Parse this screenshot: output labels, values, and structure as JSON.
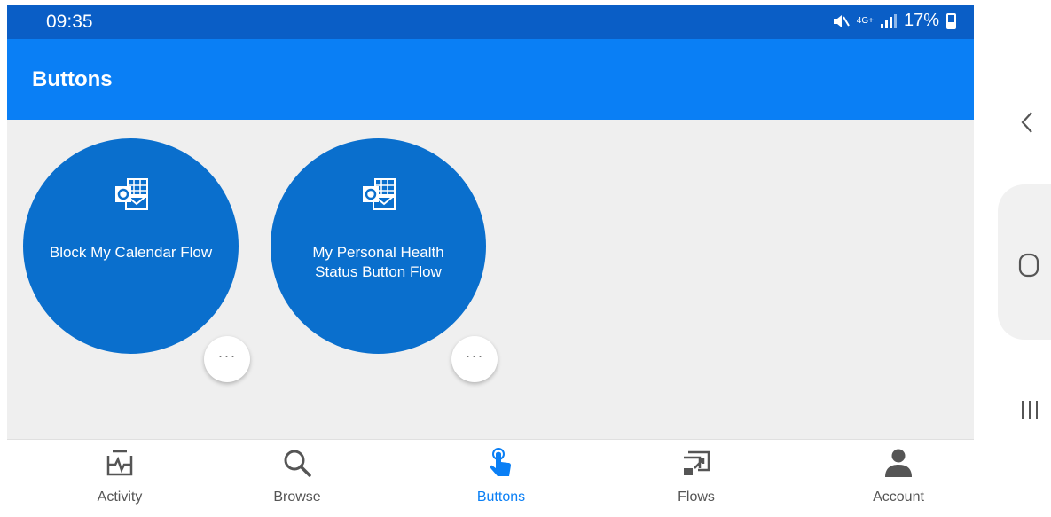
{
  "status_bar": {
    "time": "09:35",
    "network": "4G+",
    "battery": "17%"
  },
  "app_bar": {
    "title": "Buttons"
  },
  "flow_buttons": [
    {
      "label": "Block My Calendar Flow",
      "icon": "outlook-icon",
      "more": "···"
    },
    {
      "label": "My Personal Health Status Button Flow",
      "icon": "outlook-icon",
      "more": "···"
    }
  ],
  "bottom_nav": [
    {
      "label": "Activity",
      "icon": "activity-icon",
      "active": false
    },
    {
      "label": "Browse",
      "icon": "search-icon",
      "active": false
    },
    {
      "label": "Buttons",
      "icon": "touch-icon",
      "active": true
    },
    {
      "label": "Flows",
      "icon": "flows-icon",
      "active": false
    },
    {
      "label": "Account",
      "icon": "person-icon",
      "active": false
    }
  ],
  "colors": {
    "status_bar": "#0a5ec6",
    "app_bar": "#0a7ff5",
    "flow_button": "#0a6fcd",
    "nav_active": "#0a7ff5",
    "nav_inactive": "#555555"
  },
  "system_nav": [
    "back-icon",
    "home-icon",
    "recents-icon"
  ]
}
